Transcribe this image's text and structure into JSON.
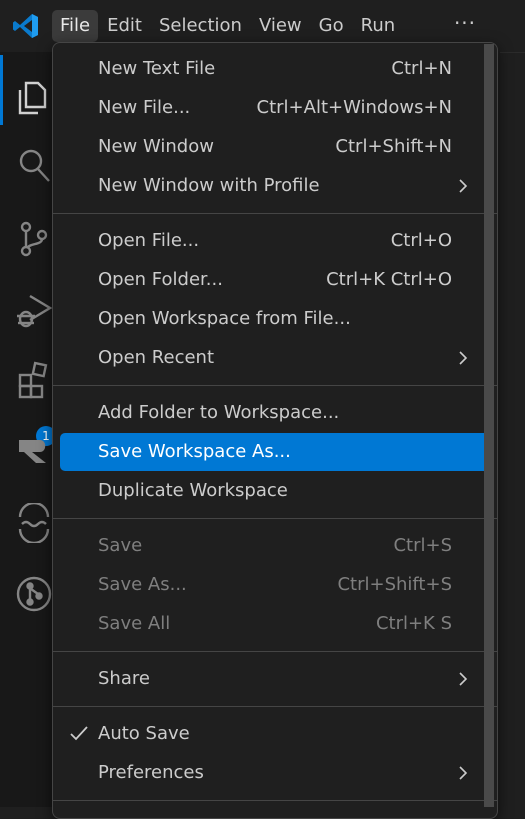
{
  "menubar": {
    "items": [
      "File",
      "Edit",
      "Selection",
      "View",
      "Go",
      "Run"
    ],
    "more": "···"
  },
  "activity_badge": "1",
  "file_menu": {
    "items": [
      {
        "label": "New Text File",
        "shortcut": "Ctrl+N"
      },
      {
        "label": "New File...",
        "shortcut": "Ctrl+Alt+Windows+N"
      },
      {
        "label": "New Window",
        "shortcut": "Ctrl+Shift+N"
      },
      {
        "label": "New Window with Profile",
        "shortcut": ""
      },
      {
        "label": "Open File...",
        "shortcut": "Ctrl+O"
      },
      {
        "label": "Open Folder...",
        "shortcut": "Ctrl+K Ctrl+O"
      },
      {
        "label": "Open Workspace from File...",
        "shortcut": ""
      },
      {
        "label": "Open Recent",
        "shortcut": ""
      },
      {
        "label": "Add Folder to Workspace...",
        "shortcut": ""
      },
      {
        "label": "Save Workspace As...",
        "shortcut": ""
      },
      {
        "label": "Duplicate Workspace",
        "shortcut": ""
      },
      {
        "label": "Save",
        "shortcut": "Ctrl+S"
      },
      {
        "label": "Save As...",
        "shortcut": "Ctrl+Shift+S"
      },
      {
        "label": "Save All",
        "shortcut": "Ctrl+K S"
      },
      {
        "label": "Share",
        "shortcut": ""
      },
      {
        "label": "Auto Save",
        "shortcut": ""
      },
      {
        "label": "Preferences",
        "shortcut": ""
      }
    ]
  },
  "colors": {
    "accent": "#0078d4",
    "menu_background": "#1f1f1f",
    "disabled_text": "#7f7f7f"
  }
}
